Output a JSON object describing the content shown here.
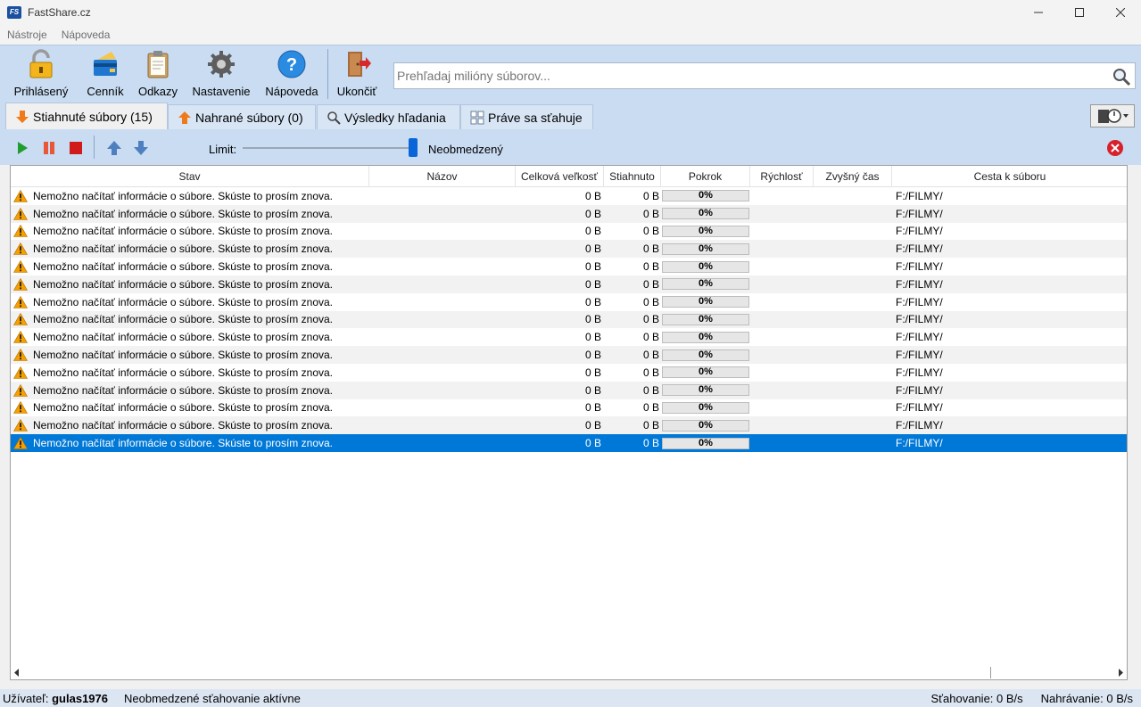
{
  "window": {
    "title": "FastShare.cz",
    "app_icon_text": "FS"
  },
  "menu": {
    "items": [
      "Nástroje",
      "Nápoveda"
    ]
  },
  "toolbar": {
    "buttons": [
      {
        "label": "Prihlásený",
        "icon": "padlock-icon"
      },
      {
        "label": "Cenník",
        "icon": "pricelist-icon"
      },
      {
        "label": "Odkazy",
        "icon": "clipboard-icon"
      },
      {
        "label": "Nastavenie",
        "icon": "gear-icon"
      },
      {
        "label": "Nápoveda",
        "icon": "help-icon"
      },
      {
        "label": "Ukončiť",
        "icon": "exit-door-icon"
      }
    ]
  },
  "search": {
    "placeholder": "Prehľadaj milióny súborov...",
    "value": ""
  },
  "tabs": [
    {
      "label": "Stiahnuté súbory (15)",
      "active": true,
      "icon": "download-arrow-icon"
    },
    {
      "label": "Nahrané súbory (0)",
      "active": false,
      "icon": "upload-arrow-icon"
    },
    {
      "label": "Výsledky hľadania",
      "active": false,
      "icon": "magnifier-icon"
    },
    {
      "label": "Práve sa sťahuje",
      "active": false,
      "icon": "list-grid-icon"
    }
  ],
  "controls": {
    "limit_label": "Limit:",
    "limit_value": "Neobmedzený",
    "limit_fraction": 1.0
  },
  "table": {
    "columns": [
      "Stav",
      "Názov",
      "Celková veľkosť",
      "Stiahnuto",
      "Pokrok",
      "Rýchlosť",
      "Zvyšný čas",
      "Cesta k súboru"
    ],
    "rows": [
      {
        "status": "Nemožno načítať informácie o súbore. Skúste to prosím znova.",
        "name": "",
        "size": "0 B",
        "downloaded": "0 B",
        "progress": "0%",
        "speed": "",
        "remaining": "",
        "path": "F:/FILMY/"
      },
      {
        "status": "Nemožno načítať informácie o súbore. Skúste to prosím znova.",
        "name": "",
        "size": "0 B",
        "downloaded": "0 B",
        "progress": "0%",
        "speed": "",
        "remaining": "",
        "path": "F:/FILMY/"
      },
      {
        "status": "Nemožno načítať informácie o súbore. Skúste to prosím znova.",
        "name": "",
        "size": "0 B",
        "downloaded": "0 B",
        "progress": "0%",
        "speed": "",
        "remaining": "",
        "path": "F:/FILMY/"
      },
      {
        "status": "Nemožno načítať informácie o súbore. Skúste to prosím znova.",
        "name": "",
        "size": "0 B",
        "downloaded": "0 B",
        "progress": "0%",
        "speed": "",
        "remaining": "",
        "path": "F:/FILMY/"
      },
      {
        "status": "Nemožno načítať informácie o súbore. Skúste to prosím znova.",
        "name": "",
        "size": "0 B",
        "downloaded": "0 B",
        "progress": "0%",
        "speed": "",
        "remaining": "",
        "path": "F:/FILMY/"
      },
      {
        "status": "Nemožno načítať informácie o súbore. Skúste to prosím znova.",
        "name": "",
        "size": "0 B",
        "downloaded": "0 B",
        "progress": "0%",
        "speed": "",
        "remaining": "",
        "path": "F:/FILMY/"
      },
      {
        "status": "Nemožno načítať informácie o súbore. Skúste to prosím znova.",
        "name": "",
        "size": "0 B",
        "downloaded": "0 B",
        "progress": "0%",
        "speed": "",
        "remaining": "",
        "path": "F:/FILMY/"
      },
      {
        "status": "Nemožno načítať informácie o súbore. Skúste to prosím znova.",
        "name": "",
        "size": "0 B",
        "downloaded": "0 B",
        "progress": "0%",
        "speed": "",
        "remaining": "",
        "path": "F:/FILMY/"
      },
      {
        "status": "Nemožno načítať informácie o súbore. Skúste to prosím znova.",
        "name": "",
        "size": "0 B",
        "downloaded": "0 B",
        "progress": "0%",
        "speed": "",
        "remaining": "",
        "path": "F:/FILMY/"
      },
      {
        "status": "Nemožno načítať informácie o súbore. Skúste to prosím znova.",
        "name": "",
        "size": "0 B",
        "downloaded": "0 B",
        "progress": "0%",
        "speed": "",
        "remaining": "",
        "path": "F:/FILMY/"
      },
      {
        "status": "Nemožno načítať informácie o súbore. Skúste to prosím znova.",
        "name": "",
        "size": "0 B",
        "downloaded": "0 B",
        "progress": "0%",
        "speed": "",
        "remaining": "",
        "path": "F:/FILMY/"
      },
      {
        "status": "Nemožno načítať informácie o súbore. Skúste to prosím znova.",
        "name": "",
        "size": "0 B",
        "downloaded": "0 B",
        "progress": "0%",
        "speed": "",
        "remaining": "",
        "path": "F:/FILMY/"
      },
      {
        "status": "Nemožno načítať informácie o súbore. Skúste to prosím znova.",
        "name": "",
        "size": "0 B",
        "downloaded": "0 B",
        "progress": "0%",
        "speed": "",
        "remaining": "",
        "path": "F:/FILMY/"
      },
      {
        "status": "Nemožno načítať informácie o súbore. Skúste to prosím znova.",
        "name": "",
        "size": "0 B",
        "downloaded": "0 B",
        "progress": "0%",
        "speed": "",
        "remaining": "",
        "path": "F:/FILMY/"
      },
      {
        "status": "Nemožno načítať informácie o súbore. Skúste to prosím znova.",
        "name": "",
        "size": "0 B",
        "downloaded": "0 B",
        "progress": "0%",
        "speed": "",
        "remaining": "",
        "path": "F:/FILMY/",
        "selected": true
      }
    ]
  },
  "statusbar": {
    "user_label": "Užívateľ:",
    "username": "gulas1976",
    "mode": "Neobmedzené sťahovanie aktívne",
    "download_rate": "Sťahovanie: 0 B/s",
    "upload_rate": "Nahrávanie: 0 B/s"
  },
  "colors": {
    "toolbar_bg": "#c9dcf2",
    "selection": "#0078d7",
    "warning": "#f5a000",
    "play": "#1f9d2e",
    "stop": "#d11a1a"
  }
}
